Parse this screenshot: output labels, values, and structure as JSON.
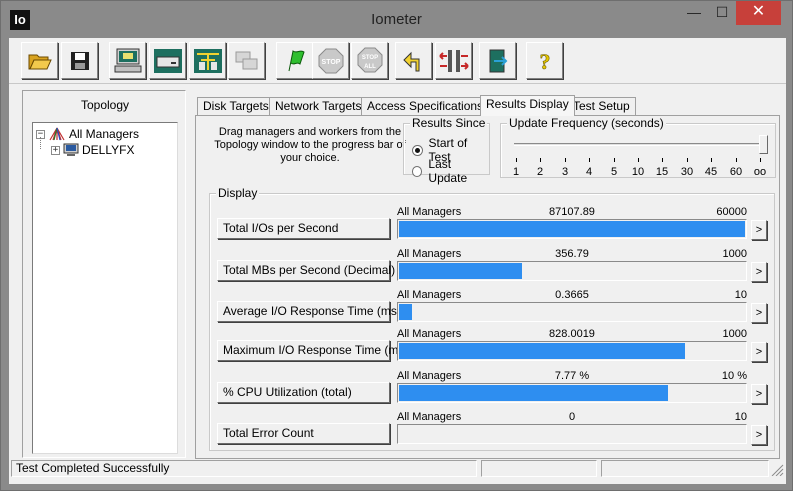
{
  "app": {
    "icon_text": "Io",
    "title": "Iometer"
  },
  "window_controls": {
    "minimize": "—",
    "maximize": "☐",
    "close": "✕"
  },
  "toolbar": {
    "buttons": [
      {
        "name": "open-config-button",
        "icon": "folder-open-icon"
      },
      {
        "name": "save-config-button",
        "icon": "floppy-disk-icon"
      },
      {
        "name": "start-new-manager-button",
        "icon": "computer-manager-icon"
      },
      {
        "name": "start-disk-worker-button",
        "icon": "disk-worker-icon"
      },
      {
        "name": "start-network-worker-button",
        "icon": "network-worker-icon"
      },
      {
        "name": "duplicate-worker-button",
        "icon": "duplicate-icon"
      },
      {
        "name": "start-tests-button",
        "icon": "green-flag-icon"
      },
      {
        "name": "stop-test-button",
        "icon": "stop-sign-icon"
      },
      {
        "name": "stop-all-button",
        "icon": "stop-all-icon"
      },
      {
        "name": "reset-workers-button",
        "icon": "reset-arrow-icon"
      },
      {
        "name": "disconnect-managers-button",
        "icon": "disconnect-icon"
      },
      {
        "name": "exit-button",
        "icon": "exit-door-icon"
      },
      {
        "name": "about-button",
        "icon": "question-mark-icon"
      }
    ]
  },
  "topology": {
    "title": "Topology",
    "root_label": "All Managers",
    "manager_label": "DELLYFX",
    "expand_root": "−",
    "expand_manager": "+"
  },
  "tabs": [
    {
      "label": "Disk Targets",
      "active": false
    },
    {
      "label": "Network Targets",
      "active": false
    },
    {
      "label": "Access Specifications",
      "active": false
    },
    {
      "label": "Results Display",
      "active": true
    },
    {
      "label": "Test Setup",
      "active": false
    }
  ],
  "results": {
    "drag_instructions": "Drag managers and workers from the Topology window to the progress bar of your choice.",
    "results_since": {
      "label": "Results Since",
      "options": [
        {
          "label": "Start of Test",
          "checked": true
        },
        {
          "label": "Last Update",
          "checked": false
        }
      ]
    },
    "update_frequency": {
      "label": "Update Frequency (seconds)",
      "ticks": [
        "1",
        "2",
        "3",
        "4",
        "5",
        "10",
        "15",
        "30",
        "45",
        "60",
        "oo"
      ],
      "selected": "oo"
    },
    "display_label": "Display",
    "metrics": [
      {
        "label": "Total I/Os per Second",
        "source": "All Managers",
        "value": "87107.89",
        "max": "60000",
        "fill": 1.0
      },
      {
        "label": "Total MBs per Second (Decimal)",
        "source": "All Managers",
        "value": "356.79",
        "max": "1000",
        "fill": 0.3568
      },
      {
        "label": "Average I/O Response Time (ms)",
        "source": "All Managers",
        "value": "0.3665",
        "max": "10",
        "fill": 0.0367
      },
      {
        "label": "Maximum I/O Response Time (ms)",
        "source": "All Managers",
        "value": "828.0019",
        "max": "1000",
        "fill": 0.828
      },
      {
        "label": "% CPU Utilization (total)",
        "source": "All Managers",
        "value": "7.77 %",
        "max": "10 %",
        "fill": 0.777
      },
      {
        "label": "Total Error Count",
        "source": "All Managers",
        "value": "0",
        "max": "10",
        "fill": 0.0
      }
    ],
    "arrow_glyph": ">"
  },
  "status": {
    "message": "Test Completed Successfully"
  },
  "colors": {
    "bar": "#2e8ef0",
    "close": "#c7403a",
    "titlebar": "#8a8a8a"
  }
}
